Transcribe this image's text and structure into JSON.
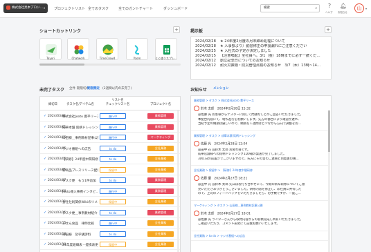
{
  "topbar": {
    "company": "株式会社見本プロジ…",
    "nav": [
      "プロジェクトリスト",
      "全てのタスク",
      "全てのガントチャート",
      "ダッシュボード"
    ],
    "search_placeholder": "検索",
    "help_label": "ヘルプ",
    "notify_label": "お知らせ",
    "avatar_initial": "山"
  },
  "shortcuts": {
    "title": "ショートカットリンク",
    "items": [
      {
        "label": "Tayori",
        "color": "#4caf50"
      },
      {
        "label": "Chatwork",
        "color": "#e53935"
      },
      {
        "label": "TimeCrowd",
        "color": "#43a047"
      },
      {
        "label": "Yoom",
        "color": "#26c6da"
      },
      {
        "label": "よく使うスプレ…",
        "color": "#0f9d58"
      }
    ]
  },
  "board": {
    "title": "掲示板",
    "rows": [
      {
        "date": "2024/02/28",
        "text": "★ 24年度2月度の月末締め処理について"
      },
      {
        "date": "2024/02/28",
        "text": "★ 人事部より）勤怠修正の申請漏れにご注意ください"
      },
      {
        "date": "2024/02/25",
        "text": "★ 入社式の予定が決定しました"
      },
      {
        "date": "2024/02/15",
        "text": "【注意喚起】全社員へ。3/1（金）18時までに必ず一読くだ…"
      },
      {
        "date": "2024/02/12",
        "text": "創立記念日についてのお知らせ"
      },
      {
        "date": "2024/02/12",
        "text": "耐火対策物・防災管理点検のお知らせ　3/7（木）13時~14…"
      }
    ]
  },
  "tasks": {
    "title": "未完了タスク",
    "filters": [
      "全件",
      "期限切れ",
      "期限間近",
      "(2週間以内の未完了)"
    ],
    "headers": [
      "締切日",
      "タスク名/アイテム名",
      "リスト名\nチェックリスト名",
      "プロジェクト名"
    ],
    "rows": [
      {
        "date": "2024/03/01",
        "name": "株式会社Jooto 豊平リース",
        "status": "進行中",
        "project": "業務管理"
      },
      {
        "date": "2024/03/01",
        "name": "成華本舗 銘柄ドレッシン…",
        "status": "進行中",
        "project": "業務管理"
      },
      {
        "date": "2024/03/05",
        "name": "山田様＿事例教材記事公開",
        "status": "進行中",
        "project": "マーケティング"
      },
      {
        "date": "2024/03/05",
        "name": "ラジオ番組への広告",
        "status": "to do",
        "project": "全社業務"
      },
      {
        "date": "2024/03/05",
        "name": "【研修】24年度中間研修…",
        "status": "to do",
        "project": "全社業務"
      },
      {
        "date": "2024/03/05",
        "name": "新商品プレスリリース配信",
        "status": "保留中",
        "project": "全社業務"
      },
      {
        "date": "2024/03/07",
        "name": "タスク便　もう1件追加",
        "status": "to do",
        "project": "業務管理"
      },
      {
        "date": "2024/03/08",
        "name": "Jooto導入事例インタビ…",
        "status": "進行中",
        "project": "業務管理"
      },
      {
        "date": "2024/03/11",
        "name": "会社社則関係Wikiのリメイ…",
        "status": "保留中",
        "project": "全社業務"
      },
      {
        "date": "2024/03/15",
        "name": "タスク便＿事例教材紹介",
        "status": "to do",
        "project": "業務管理"
      },
      {
        "date": "2024/03/15",
        "name": "ふせん食品　律師比較",
        "status": "進行中",
        "project": "全社業務"
      },
      {
        "date": "2024/03/18",
        "name": "山田様　及学講詩料",
        "status": "to do",
        "project": "全社業務"
      },
      {
        "date": "2024/03/19",
        "name": "24年度組織表・提携表更新",
        "status": "保留中",
        "project": "全社業務"
      }
    ],
    "status_colors": {
      "進行中": "#2c7be5",
      "to do": "#2c7be5",
      "保留中": "#f5a623"
    },
    "project_colors": {
      "業務管理": "#e84a5f",
      "マーケティング": "#e84a5f",
      "全社業務": "#f5a623"
    }
  },
  "news": {
    "title": "お知らせ",
    "tab": "メンション",
    "items": [
      {
        "crumb": "業務管理 > タスク > 株式会社Jooto 豊平リース",
        "user": "鈴木 太郎　2024年2月28日 15:32",
        "lines": [
          "@佐藤 光 お客様からテスターに関して問題なしとのご回答いただきました。",
          "本配合内容にて、制作進行をお願いします。先方の都合により確認が遅れ、",
          "当初予定の納期は厳しいので、納期を１週間ほど少なから方向で調整をお…"
        ]
      },
      {
        "crumb": "業務管理 > タスク > 成華本舗 銘柄ドレッシング",
        "user": "佐藤 光　2024年2月28日 12:04",
        "lines": [
          "@田中 花 @鈴木 太郎 お疲れ様です。",
          "成華店舗様への銘柄ドレッシング1D0箱の発送が完了しました。",
          "3月1日の前置きでございますので、先方にその旨のご連絡と到着後の納…"
        ]
      },
      {
        "crumb": "全社業務 > 保留中 > 【研修】24年度中間研修",
        "user": "佐藤 優　2024年2月27日 18:21",
        "lines": [
          "@田中 花 @鈴木 太郎 先日はお打ち合わせにて、今期の新卒研修についてご意",
          "見いただきありがとうございました。研修内容を修正し、非社員に共有した",
          "ので、上司のフィードバックをいただきましたら、お手数ですが、一度ご…"
        ]
      },
      {
        "crumb": "マーケティング > タスク > 山田様＿事例教材記事公開",
        "user": "鈴木 太郎　2024年2月27日 18:01",
        "lines": [
          "@佐藤 光 ライターさんから取材内容からの初稿完成し共有いただきました。",
          "ご確認いただき、コメント形式にて記載お願いいたします。"
        ]
      },
      {
        "crumb": "全社業務 > to do > ラジオ番組への広告",
        "user": "",
        "lines": []
      }
    ]
  }
}
